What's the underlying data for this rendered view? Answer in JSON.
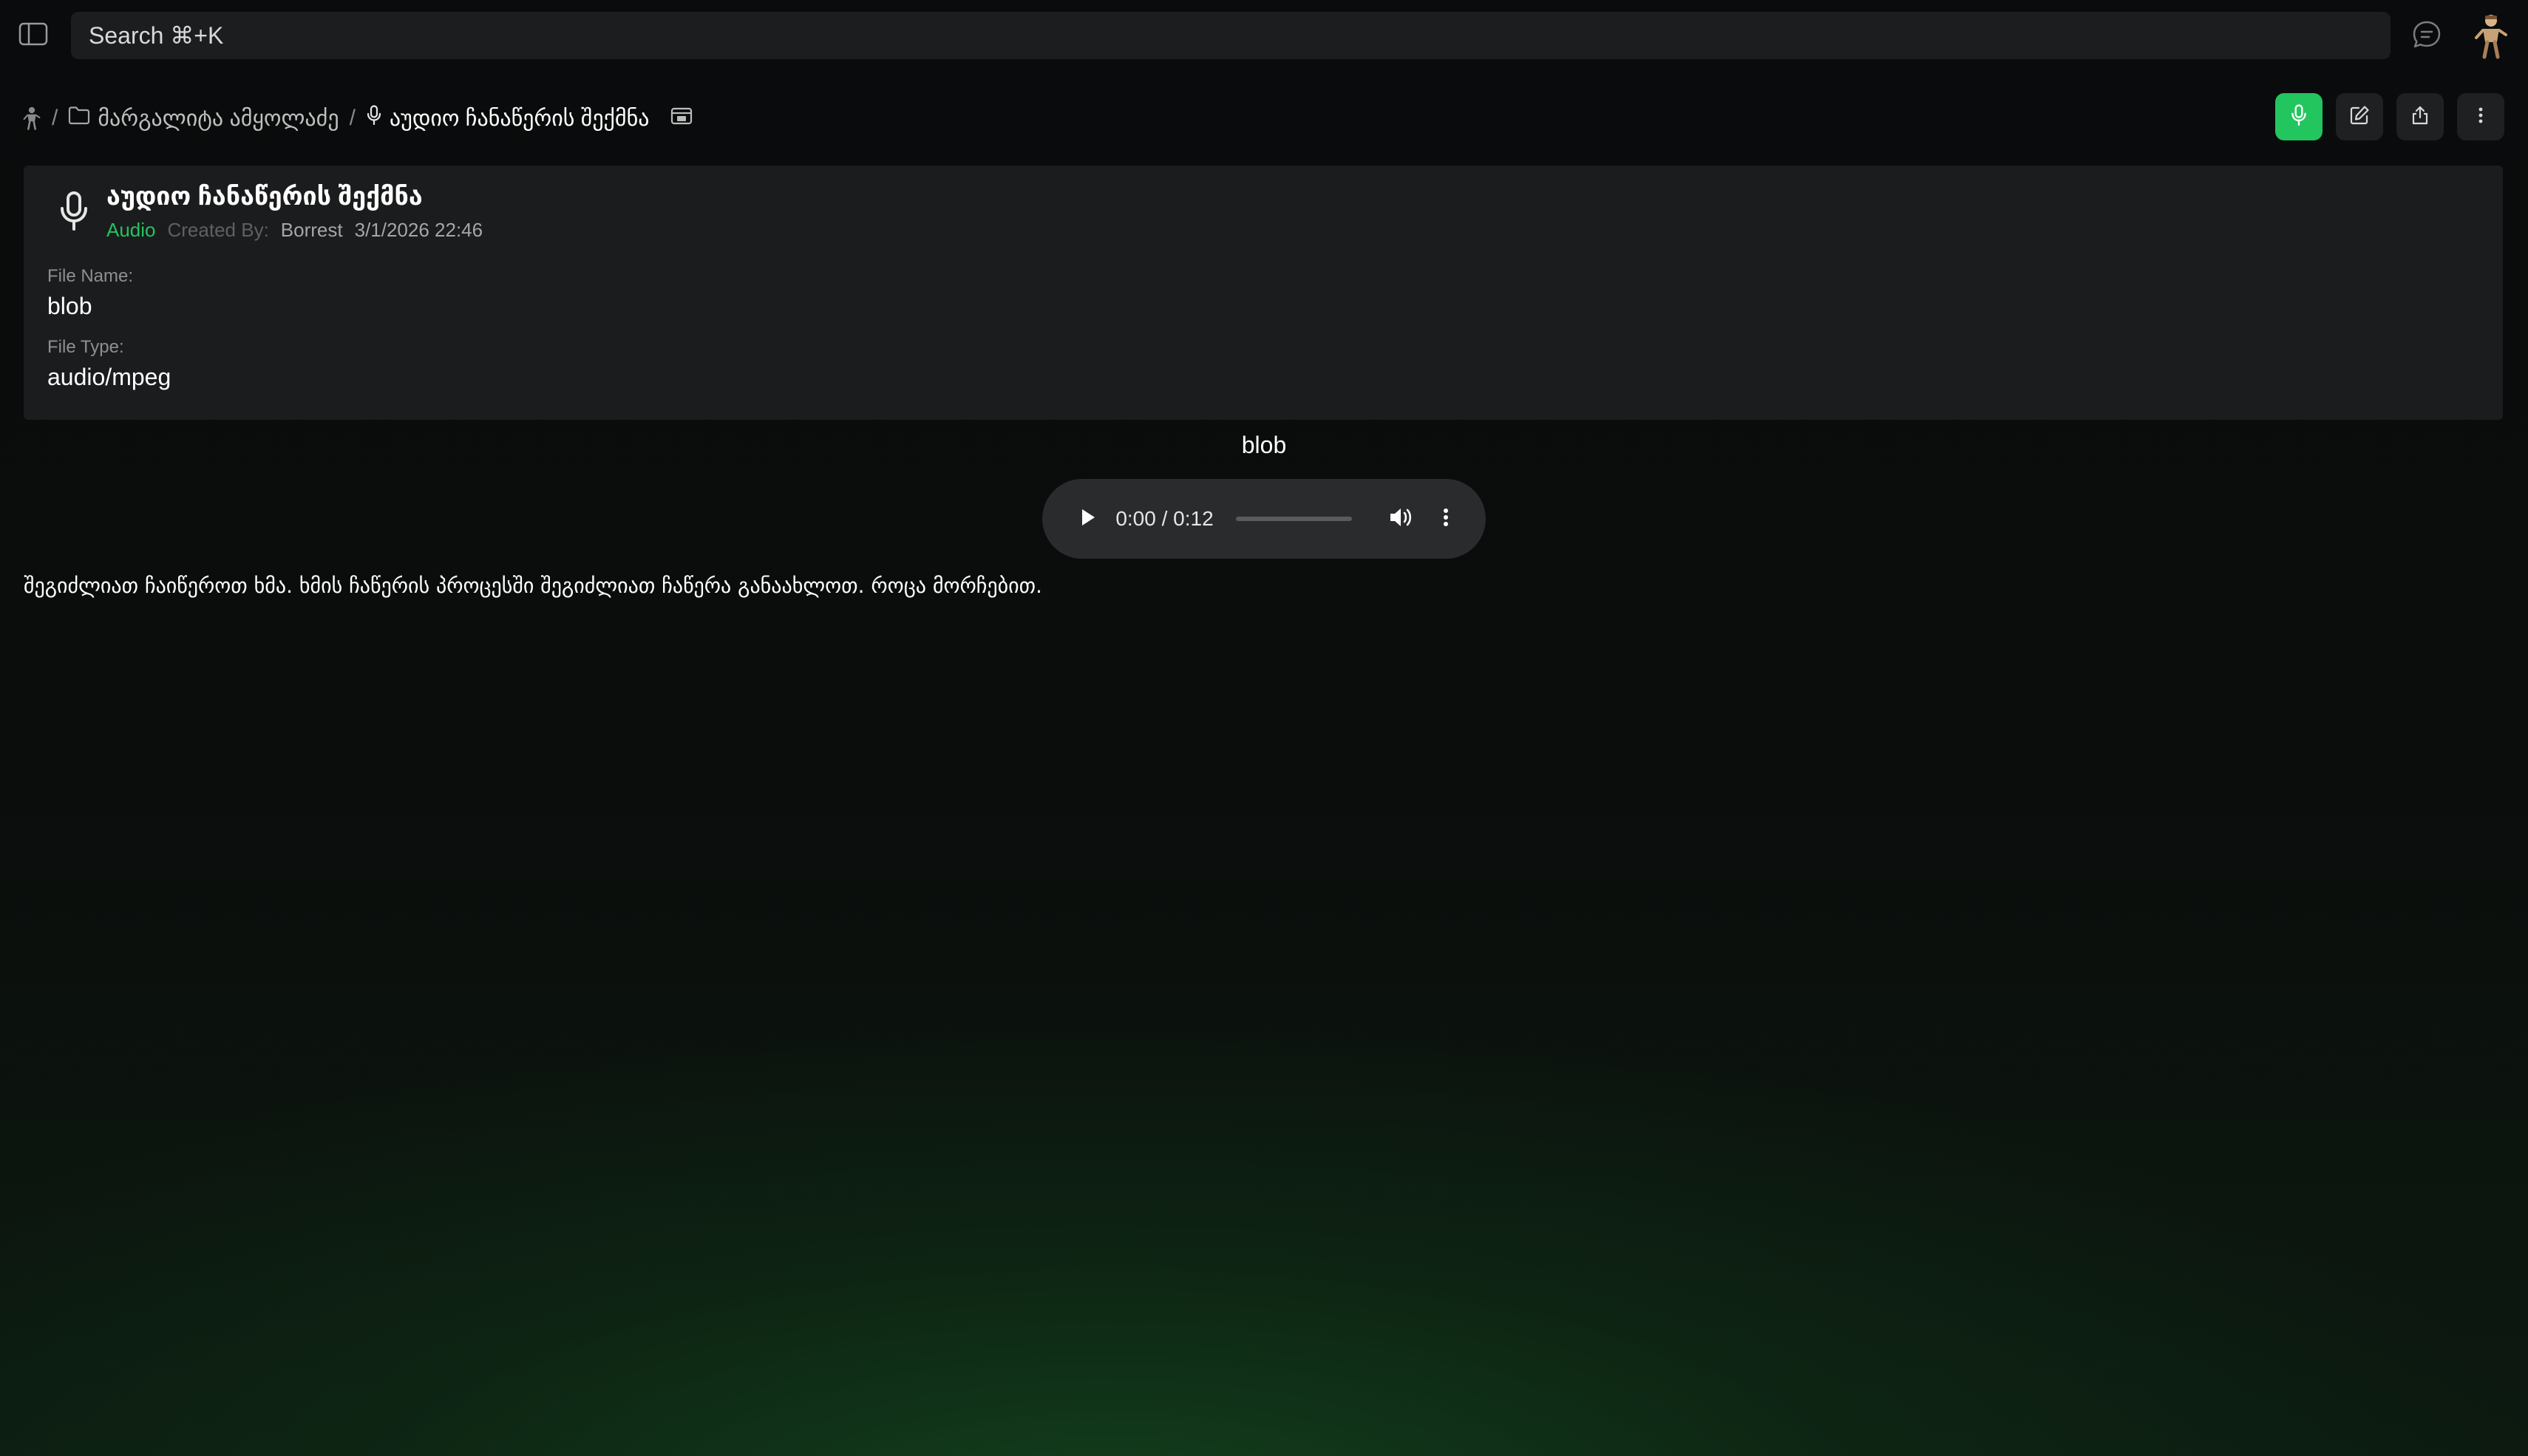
{
  "search": {
    "placeholder": "Search ⌘+K"
  },
  "breadcrumb": {
    "separator": "/",
    "folder": "მარგალიტა ამყოლაძე",
    "current": "აუდიო ჩანაწერის შექმნა"
  },
  "card": {
    "title": "აუდიო ჩანაწერის შექმნა",
    "type": "Audio",
    "created_by_label": "Created By:",
    "author": "Borrest",
    "date": "3/1/2026 22:46",
    "file_name_label": "File Name:",
    "file_name": "blob",
    "file_type_label": "File Type:",
    "file_type": "audio/mpeg"
  },
  "player": {
    "title": "blob",
    "time": "0:00 / 0:12",
    "progress": 0
  },
  "description": "შეგიძლიათ ჩაიწეროთ ხმა. ხმის ჩაწერის პროცესში შეგიძლიათ ჩაწერა განაახლოთ. როცა მორჩებით.",
  "colors": {
    "accent": "#22c55e",
    "card_bg": "#1b1c1d",
    "page_bg": "#0b0c0d"
  },
  "icons": {
    "sidebar_toggle": "sidebar-toggle-icon",
    "chat": "chat-icon",
    "mic": "microphone-icon",
    "folder": "folder-icon",
    "window": "window-icon",
    "edit": "edit-icon",
    "share": "share-icon",
    "more": "more-vertical-icon",
    "play": "play-icon",
    "volume": "volume-icon"
  }
}
